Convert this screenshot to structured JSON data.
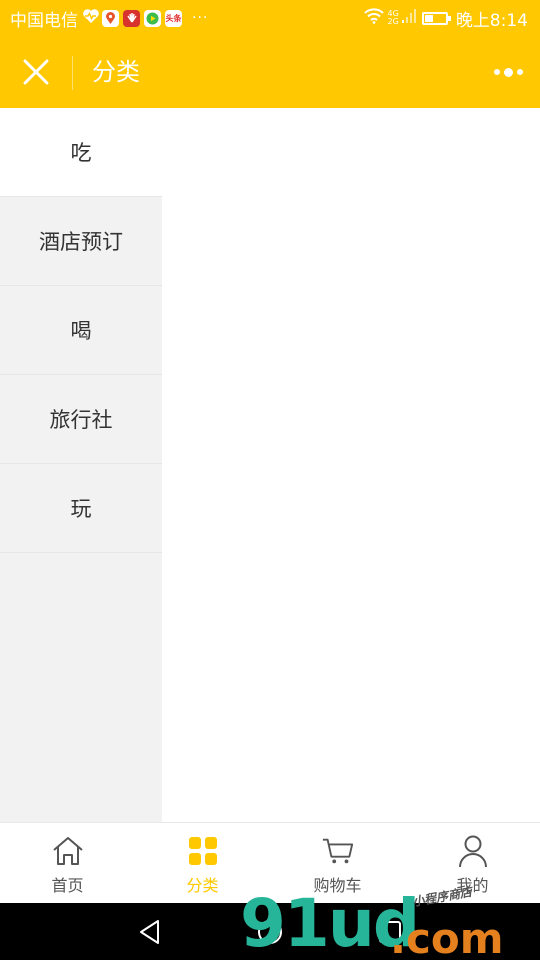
{
  "status_bar": {
    "carrier": "中国电信",
    "app_icon_label": "头条",
    "overflow": "···",
    "network": [
      "4G",
      "2G"
    ],
    "time": "晚上8:14",
    "battery_level": 0.35
  },
  "nav": {
    "title": "分类"
  },
  "categories": [
    {
      "label": "吃"
    },
    {
      "label": "酒店预订"
    },
    {
      "label": "喝"
    },
    {
      "label": "旅行社"
    },
    {
      "label": "玩"
    }
  ],
  "tabs": [
    {
      "label": "首页",
      "icon": "home-icon"
    },
    {
      "label": "分类",
      "icon": "category-grid-icon"
    },
    {
      "label": "购物车",
      "icon": "cart-icon"
    },
    {
      "label": "我的",
      "icon": "user-icon"
    }
  ],
  "watermark": {
    "main": "91ud",
    "domain": ".com",
    "small_text": "小程序商店"
  },
  "colors": {
    "accent": "#ffc800",
    "sidebar_bg": "#f2f2f2",
    "text": "#333333"
  }
}
